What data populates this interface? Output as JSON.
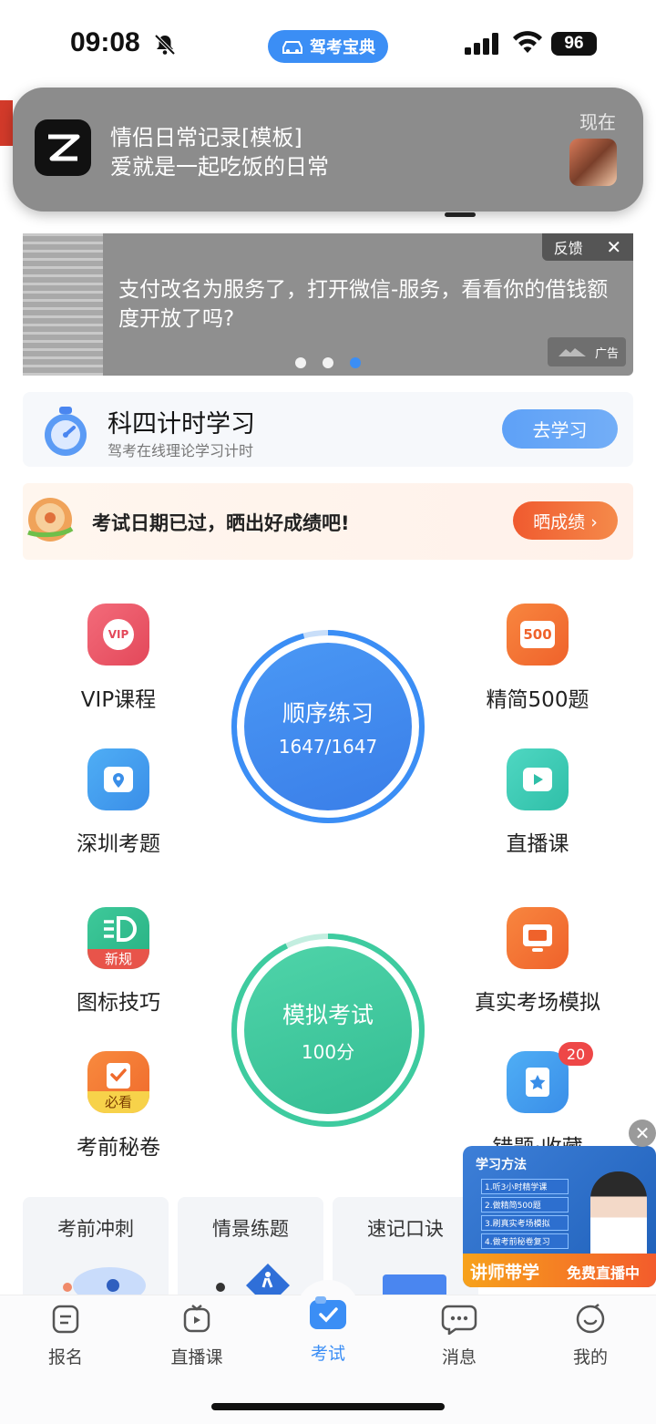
{
  "status_bar": {
    "time": "09:08",
    "app_pill": "驾考宝典",
    "battery": "96"
  },
  "notification": {
    "title": "情侣日常记录[模板]",
    "body": "爱就是一起吃饭的日常",
    "time": "现在"
  },
  "ad_banner": {
    "text": "支付改名为服务了，打开微信-服务，看看你的借钱额度开放了吗?",
    "feedback": "反馈",
    "badge": "广告"
  },
  "timer_card": {
    "title": "科四计时学习",
    "subtitle": "驾考在线理论学习计时",
    "button": "去学习"
  },
  "exam_date_card": {
    "text": "考试日期已过，晒出好成绩吧!",
    "button": "晒成绩 ›"
  },
  "grid": {
    "vip": "VIP课程",
    "jingjian": "精简500题",
    "shenzhen": "深圳考题",
    "zhibo": "直播课",
    "tubiao": "图标技巧",
    "tubiao_badge": "新规",
    "zhenshi": "真实考场模拟",
    "mijuan": "考前秘卷",
    "mijuan_badge": "必看",
    "cuoti": "错题·收藏",
    "cuoti_count": "20",
    "vip_icon_text": "VIP",
    "jingjian_icon_text": "500"
  },
  "sequence_practice": {
    "label": "顺序练习",
    "progress": "1647/1647"
  },
  "mock_exam": {
    "label": "模拟考试",
    "score": "100分"
  },
  "bottom_cards": [
    "考前冲刺",
    "情景练题",
    "速记口诀"
  ],
  "float_ad": {
    "title": "学习方法",
    "items": [
      "1.听3小时精学课",
      "2.做精简500题",
      "3.刷真实考场模拟",
      "4.做考前秘卷复习"
    ],
    "slogan": "讲师带学",
    "cta": "免费直播中"
  },
  "tab_bar": [
    {
      "label": "报名",
      "icon": "register-icon"
    },
    {
      "label": "直播课",
      "icon": "live-icon"
    },
    {
      "label": "考试",
      "icon": "exam-icon"
    },
    {
      "label": "消息",
      "icon": "message-icon"
    },
    {
      "label": "我的",
      "icon": "profile-icon"
    }
  ],
  "colors": {
    "brand_blue": "#3b8ef5",
    "mock_green": "#3ecb9f",
    "orange": "#f05a2f"
  }
}
